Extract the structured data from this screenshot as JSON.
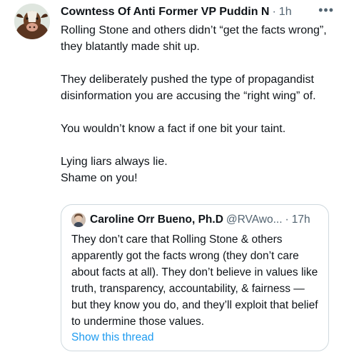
{
  "tweet": {
    "author_name": "Cowntess Of Anti Former VP Puddin N",
    "separator": "·",
    "time": "1h",
    "more_label": "•••",
    "paragraphs": [
      "Rolling Stone and others didn’t “get the facts wrong”, they blatantly made shit up.",
      "They deliberately pushed the type of propagandist disinformation you are accusing the “right wing” of.",
      "You wouldn’t know a fact if one bit your taint.",
      "Lying liars always lie.\nShame on you!"
    ],
    "avatar_icon": "cow-avatar-icon"
  },
  "quote": {
    "author_name": "Caroline Orr Bueno, Ph.D",
    "handle": "@RVAwo...",
    "separator": "·",
    "time": "17h",
    "text": "They don’t care that Rolling Stone & others apparently got the facts wrong (they don’t care about facts at all). They don’t believe in values like truth, transparency, accountability, & fairness — but they know you do, and they’ll exploit that belief to undermine those values.",
    "link_label": "Show this thread",
    "link_color": "#1d9bf0"
  }
}
